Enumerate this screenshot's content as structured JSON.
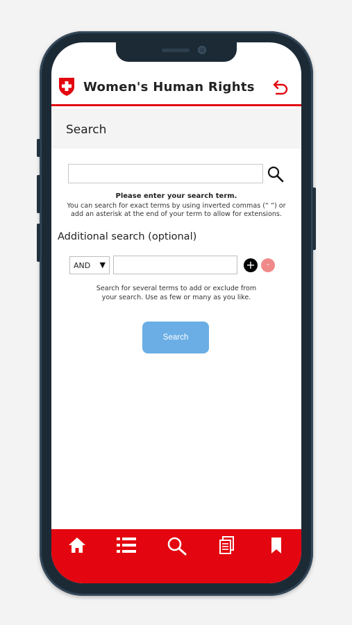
{
  "app": {
    "title": "Women's Human Rights",
    "brand_color": "#e3050f",
    "logo_icon": "swiss-cross-shield-icon",
    "back_icon": "back-arrow-icon"
  },
  "search_page": {
    "section_title": "Search",
    "search_input": {
      "value": "",
      "placeholder": ""
    },
    "search_icon": "magnifier-icon",
    "hint_title": "Please enter your search term.",
    "hint_body": "You can search for exact terms by using inverted commas (“ ”) or add an asterisk at the end of your term to allow for extensions.",
    "additional_title": "Additional search (optional)",
    "operator": {
      "selected": "AND",
      "arrow": "▼"
    },
    "term_input": {
      "value": "",
      "placeholder": ""
    },
    "add_label": "+",
    "remove_label": "-",
    "multi_hint": "Search for several terms to add or exclude from your search. Use as few or many as you like.",
    "submit_label": "Search",
    "submit_color": "#6aaee5"
  },
  "bottom_nav": {
    "items": [
      {
        "icon": "home-icon"
      },
      {
        "icon": "list-icon"
      },
      {
        "icon": "search-icon"
      },
      {
        "icon": "documents-icon"
      },
      {
        "icon": "bookmark-icon"
      }
    ]
  }
}
